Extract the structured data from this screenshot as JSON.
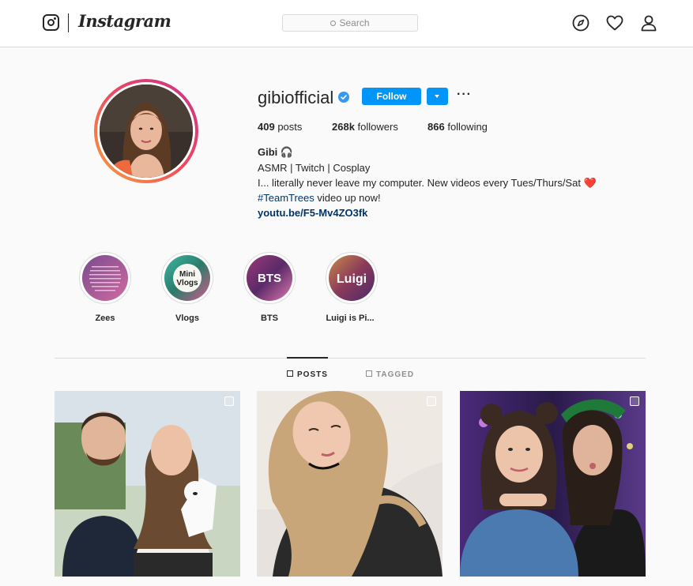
{
  "topbar": {
    "wordmark": "Instagram",
    "search_placeholder": "Search"
  },
  "profile": {
    "username": "gibiofficial",
    "follow_label": "Follow",
    "more_label": "···",
    "stats": {
      "posts_count": "409",
      "posts_label": "posts",
      "followers_count": "268k",
      "followers_label": "followers",
      "following_count": "866",
      "following_label": "following"
    },
    "bio": {
      "name": "Gibi 🎧",
      "line1": "ASMR | Twitch | Cosplay",
      "line2": "I... literally never leave my computer. New videos every Tues/Thurs/Sat ❤️",
      "hashtag": "#TeamTrees",
      "line3_rest": " video up now!",
      "link": "youtu.be/F5-Mv4ZO3fk"
    }
  },
  "highlights": [
    {
      "label": "Zees",
      "cover_text": ""
    },
    {
      "label": "Vlogs",
      "cover_text": "Mini Vlogs"
    },
    {
      "label": "BTS",
      "cover_text": "BTS"
    },
    {
      "label": "Luigi is Pi...",
      "cover_text": "Luigi"
    }
  ],
  "tabs": {
    "posts": "POSTS",
    "tagged": "TAGGED"
  },
  "colors": {
    "accent": "#0095f6",
    "link": "#003569",
    "verified": "#3897f0"
  },
  "icons": [
    "instagram-glyph-icon",
    "search-icon",
    "explore-compass-icon",
    "heart-icon",
    "profile-icon",
    "verified-badge-icon",
    "chevron-down-icon",
    "grid-icon",
    "tagged-icon",
    "multiple-posts-icon"
  ]
}
